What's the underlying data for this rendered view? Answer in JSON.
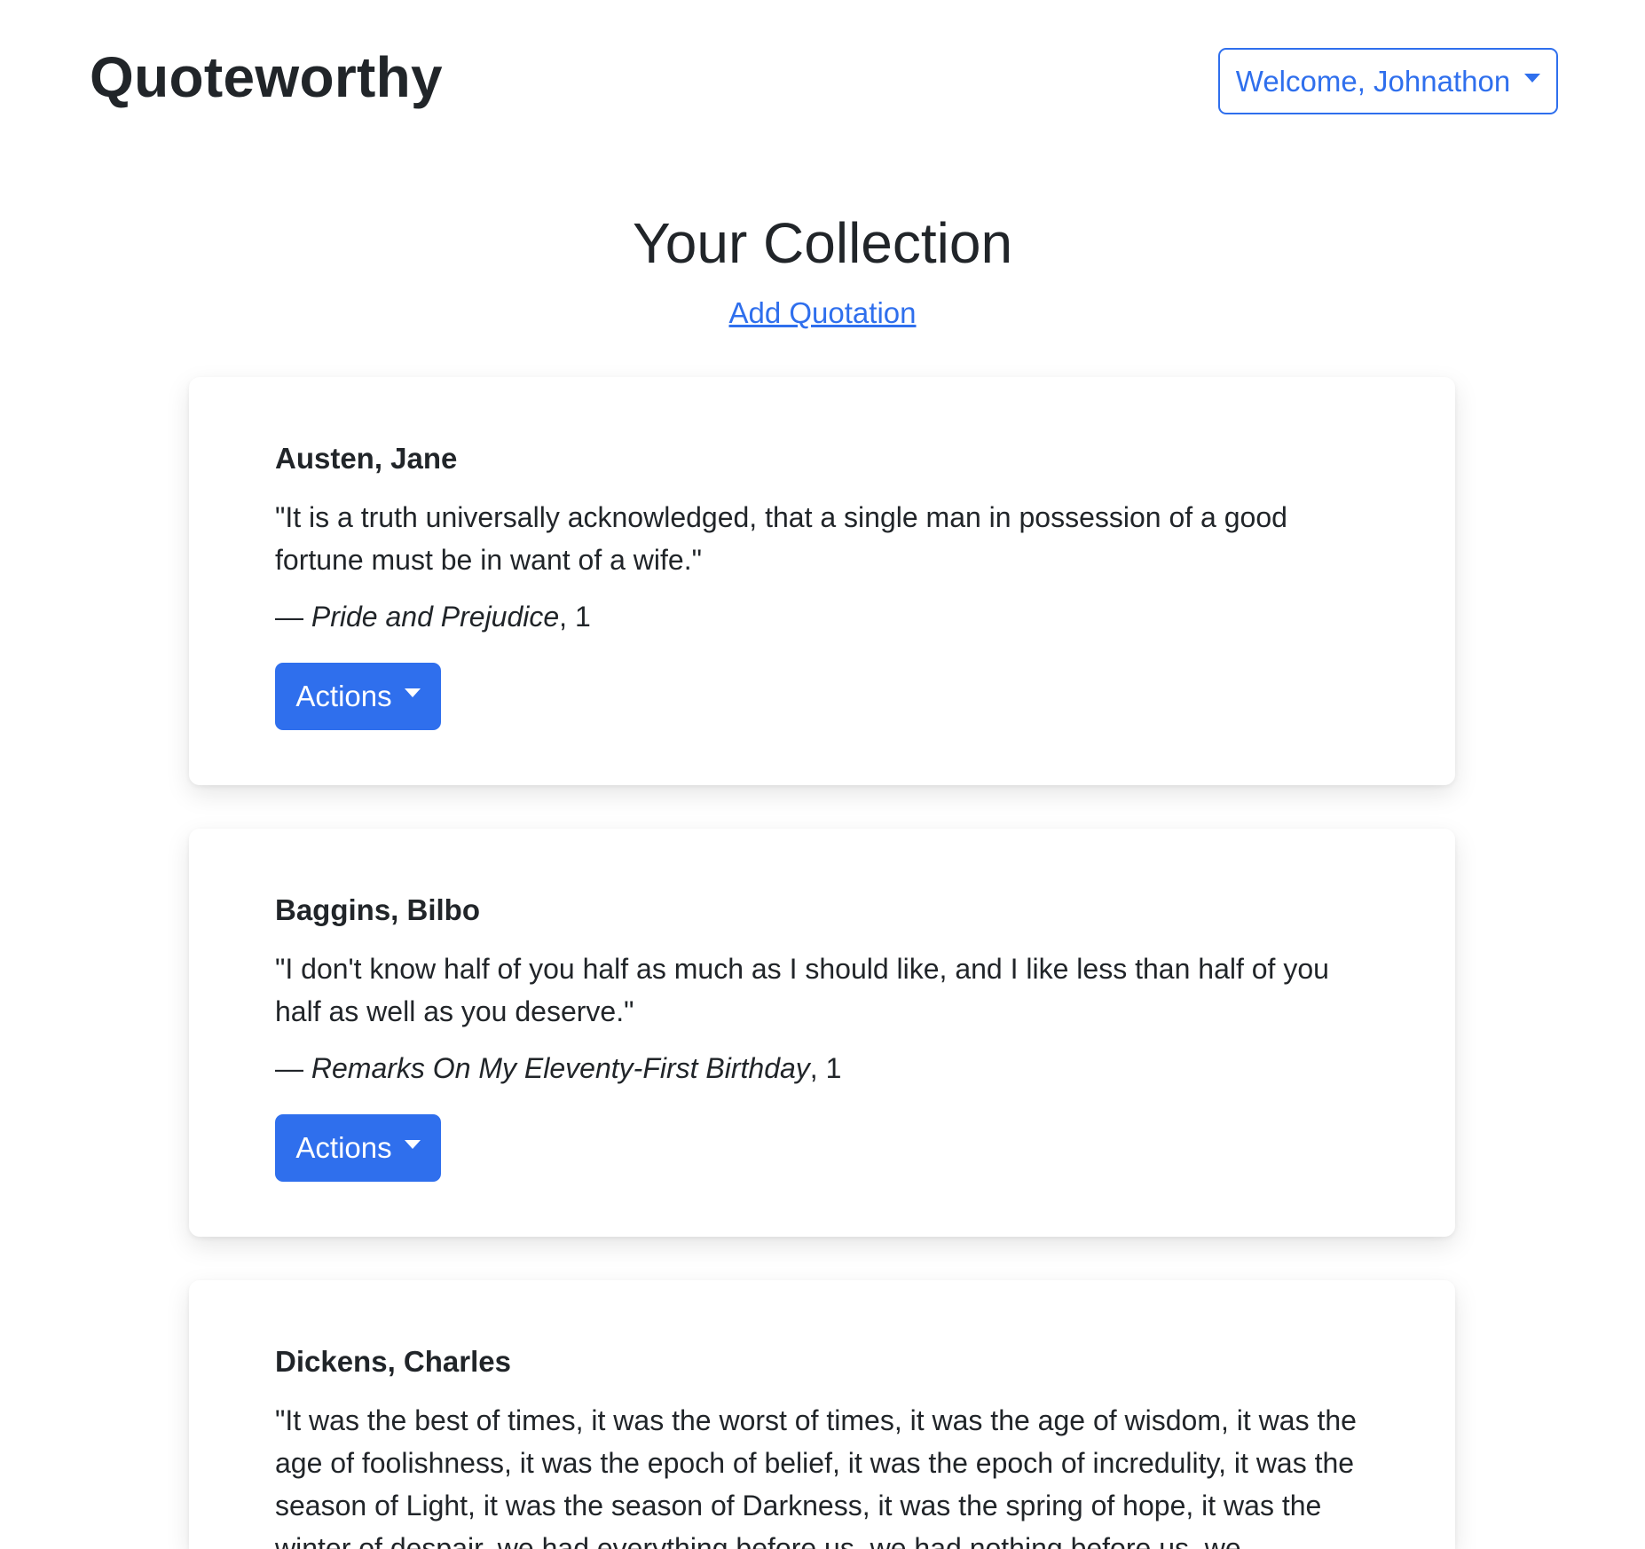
{
  "header": {
    "brand": "Quoteworthy",
    "welcome_label": "Welcome, Johnathon"
  },
  "main": {
    "title": "Your Collection",
    "add_link": "Add Quotation"
  },
  "colors": {
    "accent": "#2f6fed",
    "text": "#212529"
  },
  "quotes": [
    {
      "author": "Austen, Jane",
      "text": "\"It is a truth universally acknowledged, that a single man in possession of a good fortune must be in want of a wife.\"",
      "dash": "— ",
      "work": "Pride and Prejudice",
      "page": ", 1",
      "actions_label": "Actions"
    },
    {
      "author": "Baggins, Bilbo",
      "text": "\"I don't know half of you half as much as I should like, and I like less than half of you half as well as you deserve.\"",
      "dash": "— ",
      "work": "Remarks On My Eleventy-First Birthday",
      "page": ", 1",
      "actions_label": "Actions"
    },
    {
      "author": "Dickens, Charles",
      "text": "\"It was the best of times, it was the worst of times, it was the age of wisdom, it was the age of foolishness, it was the epoch of belief, it was the epoch of incredulity, it was the season of Light, it was the season of Darkness, it was the spring of hope, it was the winter of despair, we had everything before us, we had nothing before us, we"
    }
  ]
}
